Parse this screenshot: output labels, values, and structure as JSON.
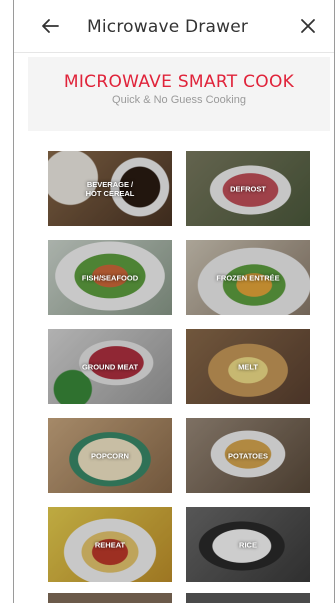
{
  "header": {
    "title": "Microwave Drawer",
    "back_icon": "back-arrow-icon",
    "close_icon": "close-icon"
  },
  "banner": {
    "title": "MICROWAVE SMART COOK",
    "subtitle": "Quick & No Guess Cooking"
  },
  "categories": [
    {
      "label": "BEVERAGE /\nHOT CEREAL"
    },
    {
      "label": "DEFROST"
    },
    {
      "label": "FISH/SEAFOOD"
    },
    {
      "label": "FROZEN ENTRÉE"
    },
    {
      "label": "GROUND MEAT"
    },
    {
      "label": "MELT"
    },
    {
      "label": "POPCORN"
    },
    {
      "label": "POTATOES"
    },
    {
      "label": "REHEAT"
    },
    {
      "label": "RICE"
    }
  ],
  "colors": {
    "accent": "#e0233a"
  }
}
